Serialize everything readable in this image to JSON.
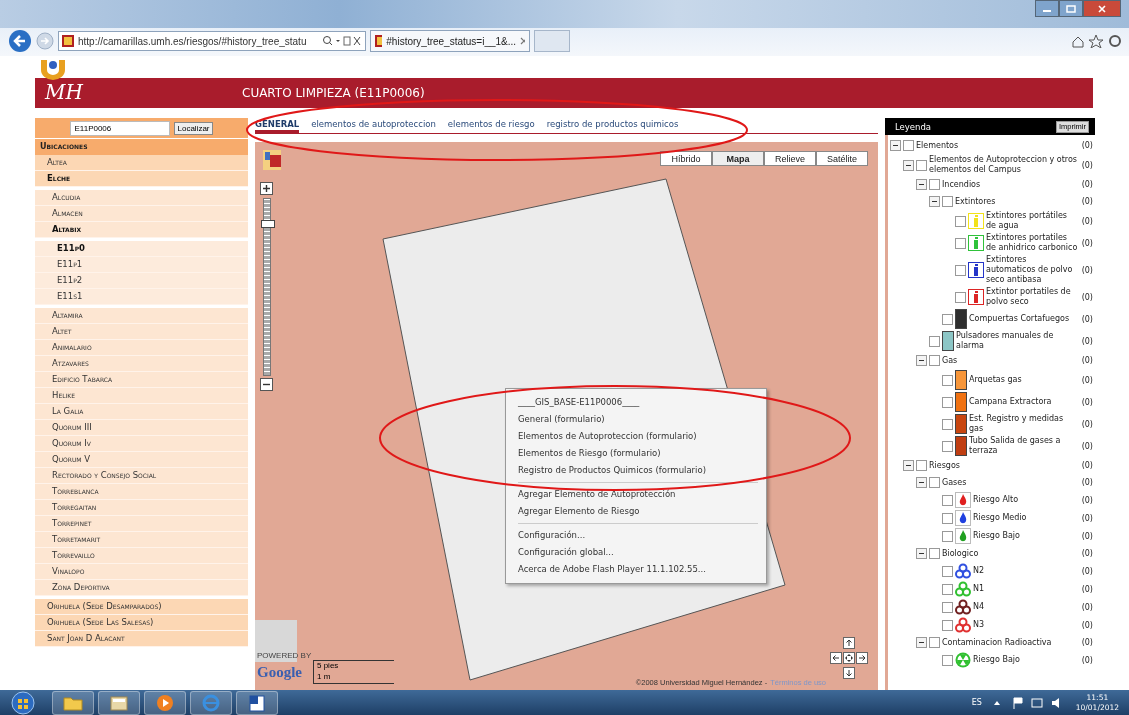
{
  "browser": {
    "address": "http://camarillas.umh.es/riesgos/#history_tree_statu",
    "tab": "#history_tree_status=i__1&..."
  },
  "header": {
    "logo": "MH",
    "title": "CUARTO LIMPIEZA (E11P0006)"
  },
  "sidebar": {
    "search": {
      "value": "E11P0006",
      "button": "Localizar"
    },
    "heading": "Ubicaciones",
    "items": [
      {
        "label": "Altea",
        "selected": false
      },
      {
        "label": "Elche",
        "selected": true,
        "expanded": true,
        "children": [
          {
            "label": "Alcudia",
            "selected": false
          },
          {
            "label": "Almacen",
            "selected": false
          },
          {
            "label": "Altabix",
            "selected": true,
            "expanded": true,
            "children": [
              {
                "label": "E11p0",
                "selected": true
              },
              {
                "label": "E11p1",
                "selected": false
              },
              {
                "label": "E11p2",
                "selected": false
              },
              {
                "label": "E11s1",
                "selected": false
              }
            ]
          },
          {
            "label": "Altamira",
            "selected": false
          },
          {
            "label": "Altet",
            "selected": false
          },
          {
            "label": "Animalario",
            "selected": false
          },
          {
            "label": "Atzavares",
            "selected": false
          },
          {
            "label": "Edificio Tabarca",
            "selected": false
          },
          {
            "label": "Helike",
            "selected": false
          },
          {
            "label": "La Galia",
            "selected": false
          },
          {
            "label": "Quorum III",
            "selected": false
          },
          {
            "label": "Quorum Iv",
            "selected": false
          },
          {
            "label": "Quorum V",
            "selected": false
          },
          {
            "label": "Rectorado y Consejo Social",
            "selected": false
          },
          {
            "label": "Torreblanca",
            "selected": false
          },
          {
            "label": "Torregaitan",
            "selected": false
          },
          {
            "label": "Torrepinet",
            "selected": false
          },
          {
            "label": "Torretamarit",
            "selected": false
          },
          {
            "label": "Torrevaillo",
            "selected": false
          },
          {
            "label": "Vinalopo",
            "selected": false
          },
          {
            "label": "Zona Deportiva",
            "selected": false
          }
        ]
      },
      {
        "label": "Orihuela (Sede Desamparados)",
        "selected": false
      },
      {
        "label": "Orihuela (Sede Las Salesas)",
        "selected": false
      },
      {
        "label": "Sant Joan D Alacant",
        "selected": false
      }
    ]
  },
  "tabs": [
    {
      "label": "GENERAL",
      "selected": true
    },
    {
      "label": "elementos de autoproteccion",
      "selected": false
    },
    {
      "label": "elementos de riesgo",
      "selected": false
    },
    {
      "label": "registro de productos quimicos",
      "selected": false
    }
  ],
  "map": {
    "zoom": {
      "level": 0.87
    },
    "map_types": [
      {
        "label": "Híbrido",
        "selected": false
      },
      {
        "label": "Mapa",
        "selected": true
      },
      {
        "label": "Relieve",
        "selected": false
      },
      {
        "label": "Satélite",
        "selected": false
      }
    ],
    "context_menu": [
      [
        "____GIS_BASE-E11P0006____",
        "General (formulario)",
        "Elementos de Autoproteccion (formulario)",
        "Elementos de Riesgo (formulario)",
        "Registro de Productos Quimicos (formulario)"
      ],
      [
        "Agregar Elemento de Autoprotección",
        "Agregar Elemento de Riesgo"
      ],
      [
        "Configuración...",
        "Configuración global...",
        "Acerca de Adobe Flash Player 11.1.102.55..."
      ]
    ],
    "powered_by": "POWERED BY",
    "google": "Google",
    "scale": {
      "top": "5 pies",
      "bottom": "1 m"
    },
    "copyright": "©2008 Universidad Miguel Hernández -",
    "terms": "Términos de uso"
  },
  "legend": {
    "title": "Leyenda",
    "print": "Imprimir",
    "items": [
      {
        "kind": "group",
        "label": "Elementos",
        "count": "(0)",
        "checked": false,
        "expanded": true,
        "children": [
          {
            "kind": "group",
            "label": "Elementos de Autoproteccion y otros elementos del Campus",
            "count": "(0)",
            "checked": false,
            "expanded": true,
            "children": [
              {
                "kind": "group",
                "label": "Incendios",
                "count": "(0)",
                "checked": false,
                "expanded": true,
                "children": [
                  {
                    "kind": "group",
                    "label": "Extintores",
                    "count": "(0)",
                    "checked": false,
                    "expanded": true,
                    "children": [
                      {
                        "kind": "extinguisher",
                        "color": "#f2e21a",
                        "label": "Extintores portátiles de agua",
                        "count": "(0)",
                        "checked": false
                      },
                      {
                        "kind": "extinguisher",
                        "color": "#2fc23a",
                        "label": "Extintores portatiles de anhidrico carbonico",
                        "count": "(0)",
                        "checked": false
                      },
                      {
                        "kind": "extinguisher",
                        "color": "#2434c8",
                        "label": "Extintores automaticos de polvo seco antibasa",
                        "count": "(0)",
                        "checked": false
                      },
                      {
                        "kind": "extinguisher",
                        "color": "#dc2424",
                        "label": "Extintor portatiles de polvo seco",
                        "count": "(0)",
                        "checked": false
                      }
                    ]
                  },
                  {
                    "kind": "swatch",
                    "color": "#2e2e2e",
                    "label": "Compuertas Cortafuegos",
                    "count": "(0)",
                    "checked": false
                  }
                ]
              },
              {
                "kind": "swatch",
                "color": "#8cc6c6",
                "label": "Pulsadores manuales de alarma",
                "count": "(0)",
                "checked": false
              },
              {
                "kind": "group",
                "label": "Gas",
                "count": "(0)",
                "checked": false,
                "expanded": true,
                "children": [
                  {
                    "kind": "swatch",
                    "color": "#f7963a",
                    "label": "Arquetas gas",
                    "count": "(0)",
                    "checked": false
                  },
                  {
                    "kind": "swatch",
                    "color": "#f07212",
                    "label": "Campana Extractora",
                    "count": "(0)",
                    "checked": false
                  },
                  {
                    "kind": "swatch",
                    "color": "#c84610",
                    "label": "Est. Registro y medidas gas",
                    "count": "(0)",
                    "checked": false
                  },
                  {
                    "kind": "swatch",
                    "color": "#c03e12",
                    "label": "Tubo Salida de gases a terraza",
                    "count": "(0)",
                    "checked": false
                  }
                ]
              }
            ]
          },
          {
            "kind": "group",
            "label": "Riesgos",
            "count": "(0)",
            "checked": false,
            "expanded": true,
            "children": [
              {
                "kind": "group",
                "label": "Gases",
                "count": "(0)",
                "checked": false,
                "expanded": true,
                "children": [
                  {
                    "kind": "flame",
                    "color": "#e02020",
                    "label": "Riesgo Alto",
                    "count": "(0)",
                    "checked": false
                  },
                  {
                    "kind": "flame",
                    "color": "#2040e0",
                    "label": "Riesgo Medio",
                    "count": "(0)",
                    "checked": false
                  },
                  {
                    "kind": "flame",
                    "color": "#20a020",
                    "label": "Riesgo Bajo",
                    "count": "(0)",
                    "checked": false
                  }
                ]
              },
              {
                "kind": "group",
                "label": "Biologico",
                "count": "(0)",
                "checked": false,
                "expanded": true,
                "children": [
                  {
                    "kind": "biohazard",
                    "color": "#3050e0",
                    "label": "N2",
                    "count": "(0)",
                    "checked": false
                  },
                  {
                    "kind": "biohazard",
                    "color": "#30c030",
                    "label": "N1",
                    "count": "(0)",
                    "checked": false
                  },
                  {
                    "kind": "biohazard",
                    "color": "#702020",
                    "label": "N4",
                    "count": "(0)",
                    "checked": false
                  },
                  {
                    "kind": "biohazard",
                    "color": "#e03030",
                    "label": "N3",
                    "count": "(0)",
                    "checked": false
                  }
                ]
              },
              {
                "kind": "group",
                "label": "Contaminacion Radioactiva",
                "count": "(0)",
                "checked": false,
                "expanded": true,
                "children": [
                  {
                    "kind": "radiation",
                    "color": "#30c030",
                    "label": "Riesgo Bajo",
                    "count": "(0)",
                    "checked": false
                  }
                ]
              }
            ]
          }
        ]
      }
    ]
  },
  "taskbar": {
    "language": "ES",
    "time": "11:51",
    "date": "10/01/2012"
  }
}
